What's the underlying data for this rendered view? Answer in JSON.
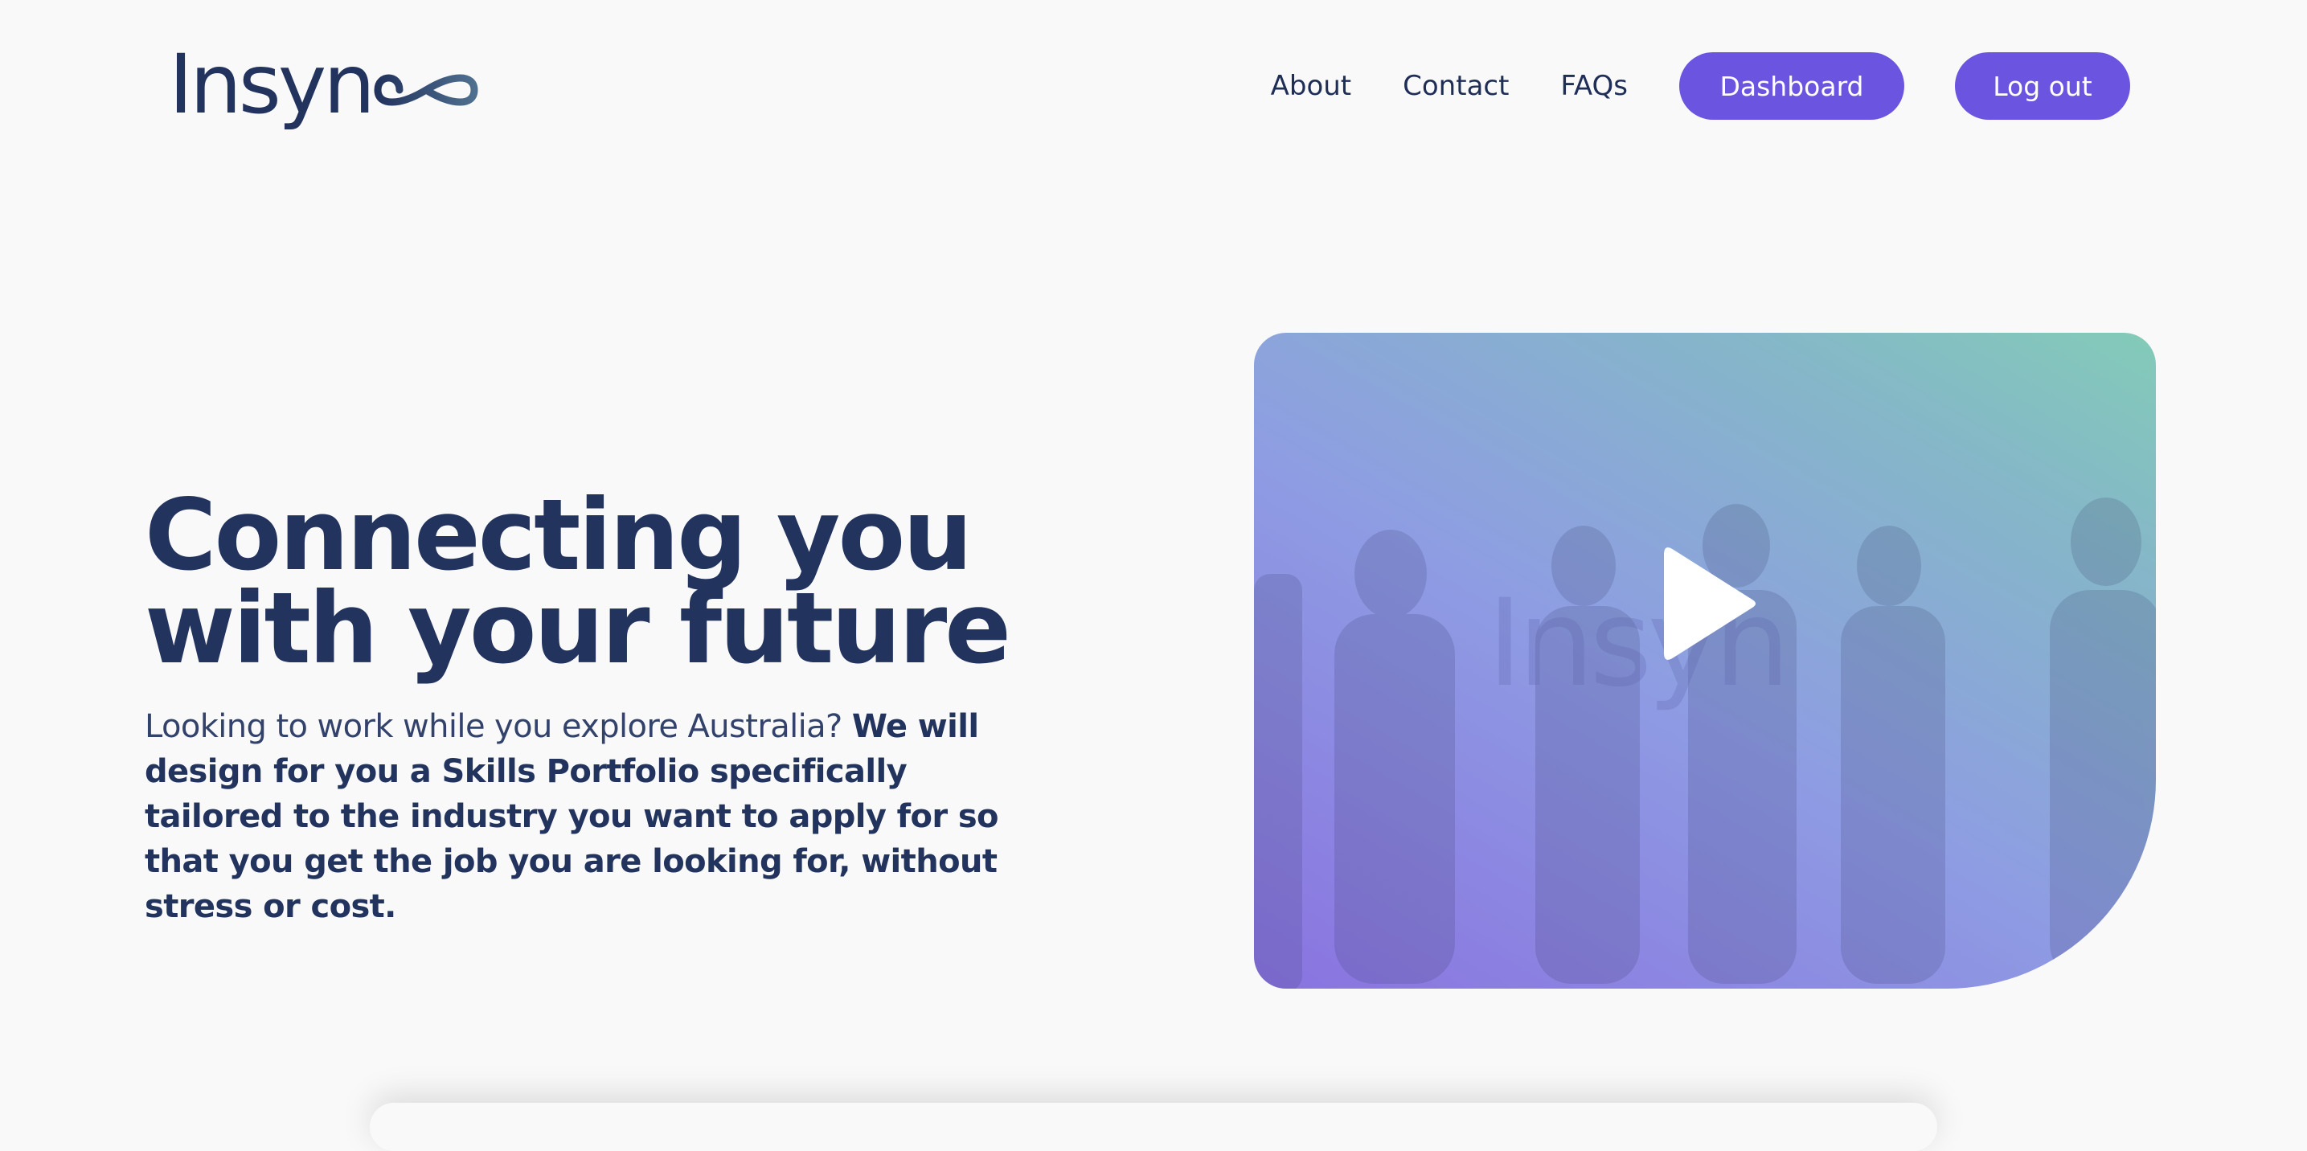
{
  "logo": {
    "text": "Insyn",
    "icon": "infinity-icon"
  },
  "nav": {
    "links": [
      "About",
      "Contact",
      "FAQs"
    ],
    "dashboard_label": "Dashboard",
    "logout_label": "Log out"
  },
  "hero": {
    "title_line1": "Connecting you",
    "title_line2": "with your future",
    "text_light": "Looking to work while you explore Australia?",
    "text_bold": "We will design for you a Skills Portfolio specifically tailored to the industry you want to apply for so that you get the job you are looking for, without stress or cost."
  },
  "video": {
    "watermark": "Insyn",
    "play_icon": "play-icon"
  },
  "colors": {
    "brand_navy": "#22335e",
    "button_purple": "#6b55e0",
    "page_bg": "#f9f9fa",
    "gradient_start": "#8a73e0",
    "gradient_end": "#83cbb8"
  }
}
